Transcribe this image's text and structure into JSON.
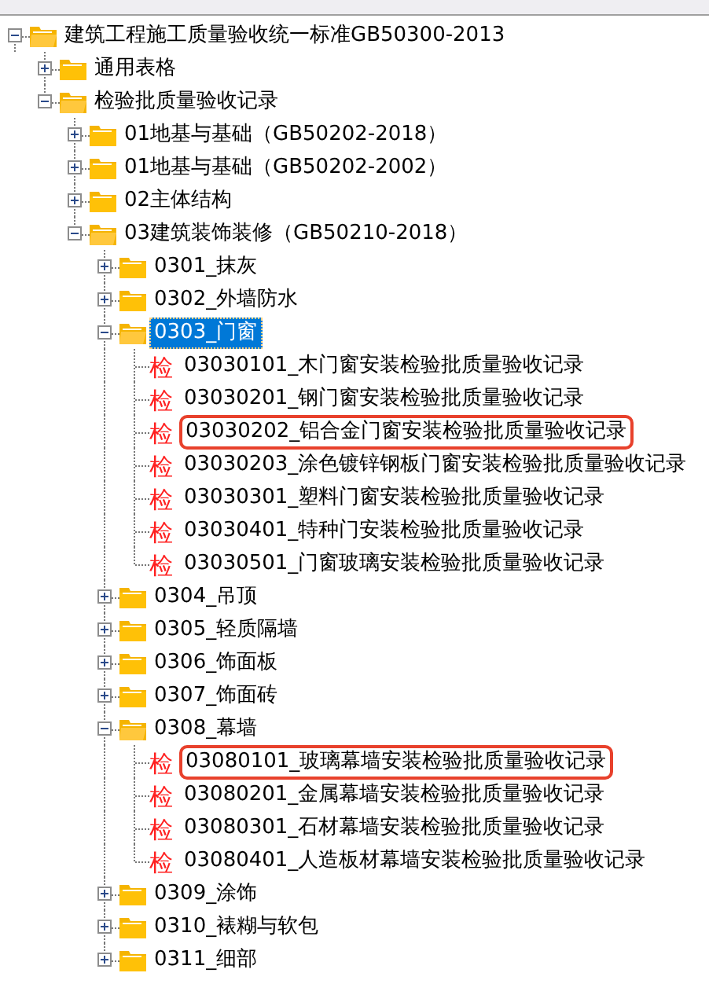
{
  "tree": [
    {
      "label": "建筑工程施工质量验收统一标准GB50300-2013",
      "kind": "folder",
      "expanded": true,
      "children": [
        {
          "label": "通用表格",
          "kind": "folder",
          "expanded": false
        },
        {
          "label": "检验批质量验收记录",
          "kind": "folder",
          "expanded": true,
          "children": [
            {
              "label": "01地基与基础（GB50202-2018）",
              "kind": "folder",
              "expanded": false
            },
            {
              "label": "01地基与基础（GB50202-2002）",
              "kind": "folder",
              "expanded": false
            },
            {
              "label": "02主体结构",
              "kind": "folder",
              "expanded": false
            },
            {
              "label": "03建筑装饰装修（GB50210-2018）",
              "kind": "folder",
              "expanded": true,
              "children": [
                {
                  "label": "0301_抹灰",
                  "kind": "folder",
                  "expanded": false
                },
                {
                  "label": "0302_外墙防水",
                  "kind": "folder",
                  "expanded": false
                },
                {
                  "label": "0303_门窗",
                  "kind": "folder",
                  "expanded": true,
                  "selected": true,
                  "children": [
                    {
                      "label": "03030101_木门窗安装检验批质量验收记录",
                      "kind": "record",
                      "badge": "检"
                    },
                    {
                      "label": "03030201_钢门窗安装检验批质量验收记录",
                      "kind": "record",
                      "badge": "检"
                    },
                    {
                      "label": "03030202_铝合金门窗安装检验批质量验收记录",
                      "kind": "record",
                      "badge": "检",
                      "highlighted": true
                    },
                    {
                      "label": "03030203_涂色镀锌钢板门窗安装检验批质量验收记录",
                      "kind": "record",
                      "badge": "检"
                    },
                    {
                      "label": "03030301_塑料门窗安装检验批质量验收记录",
                      "kind": "record",
                      "badge": "检"
                    },
                    {
                      "label": "03030401_特种门安装检验批质量验收记录",
                      "kind": "record",
                      "badge": "检"
                    },
                    {
                      "label": "03030501_门窗玻璃安装检验批质量验收记录",
                      "kind": "record",
                      "badge": "检"
                    }
                  ]
                },
                {
                  "label": "0304_吊顶",
                  "kind": "folder",
                  "expanded": false
                },
                {
                  "label": "0305_轻质隔墙",
                  "kind": "folder",
                  "expanded": false
                },
                {
                  "label": "0306_饰面板",
                  "kind": "folder",
                  "expanded": false
                },
                {
                  "label": "0307_饰面砖",
                  "kind": "folder",
                  "expanded": false
                },
                {
                  "label": "0308_幕墙",
                  "kind": "folder",
                  "expanded": true,
                  "children": [
                    {
                      "label": "03080101_玻璃幕墙安装检验批质量验收记录",
                      "kind": "record",
                      "badge": "检",
                      "highlighted": true
                    },
                    {
                      "label": "03080201_金属幕墙安装检验批质量验收记录",
                      "kind": "record",
                      "badge": "检"
                    },
                    {
                      "label": "03080301_石材幕墙安装检验批质量验收记录",
                      "kind": "record",
                      "badge": "检"
                    },
                    {
                      "label": "03080401_人造板材幕墙安装检验批质量验收记录",
                      "kind": "record",
                      "badge": "检"
                    }
                  ]
                },
                {
                  "label": "0309_涂饰",
                  "kind": "folder",
                  "expanded": false
                },
                {
                  "label": "0310_裱糊与软包",
                  "kind": "folder",
                  "expanded": false
                },
                {
                  "label": "0311_细部",
                  "kind": "folder",
                  "expanded": false
                }
              ]
            }
          ]
        }
      ]
    }
  ]
}
